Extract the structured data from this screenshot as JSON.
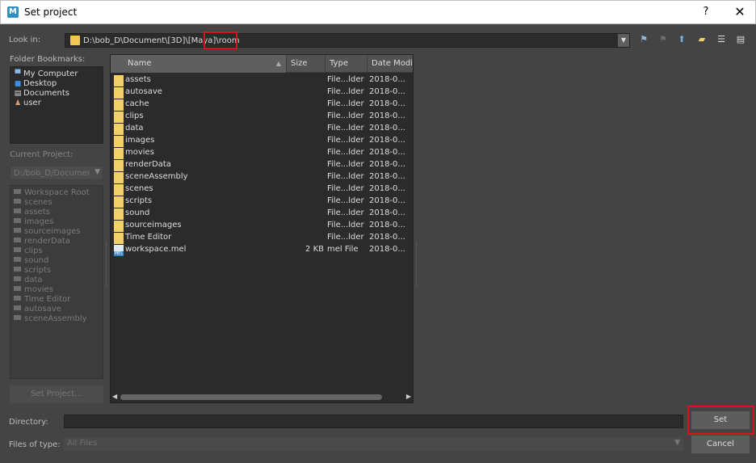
{
  "window": {
    "title": "Set project",
    "app_icon": "M",
    "help": "?",
    "close": "✕"
  },
  "lookin": {
    "label": "Look in:",
    "path": "D:\\bob_D\\Document\\[3D]\\[Maya]\\room"
  },
  "toolbar_icons": [
    "back-icon",
    "forward-icon",
    "parent-folder-icon",
    "new-folder-icon",
    "list-view-icon",
    "detail-view-icon"
  ],
  "bookmarks": {
    "label": "Folder Bookmarks:",
    "items": [
      {
        "label": "My Computer",
        "icon": "computer-icon"
      },
      {
        "label": "Desktop",
        "icon": "desktop-icon"
      },
      {
        "label": "Documents",
        "icon": "documents-icon"
      },
      {
        "label": "user",
        "icon": "user-icon"
      }
    ]
  },
  "current_project": {
    "label": "Current Project:",
    "value": "D:/bob_D/Documen"
  },
  "workspace": {
    "items": [
      "Workspace Root",
      "scenes",
      "assets",
      "images",
      "sourceimages",
      "renderData",
      "clips",
      "sound",
      "scripts",
      "data",
      "movies",
      "Time Editor",
      "autosave",
      "sceneAssembly"
    ]
  },
  "set_project_button": "Set Project...",
  "filelist": {
    "columns": [
      "Name",
      "Size",
      "Type",
      "Date Modi"
    ],
    "rows": [
      {
        "name": "assets",
        "size": "",
        "type": "File...lder",
        "date": "2018-0...",
        "kind": "folder"
      },
      {
        "name": "autosave",
        "size": "",
        "type": "File...lder",
        "date": "2018-0...",
        "kind": "folder"
      },
      {
        "name": "cache",
        "size": "",
        "type": "File...lder",
        "date": "2018-0...",
        "kind": "folder"
      },
      {
        "name": "clips",
        "size": "",
        "type": "File...lder",
        "date": "2018-0...",
        "kind": "folder"
      },
      {
        "name": "data",
        "size": "",
        "type": "File...lder",
        "date": "2018-0...",
        "kind": "folder"
      },
      {
        "name": "images",
        "size": "",
        "type": "File...lder",
        "date": "2018-0...",
        "kind": "folder"
      },
      {
        "name": "movies",
        "size": "",
        "type": "File...lder",
        "date": "2018-0...",
        "kind": "folder"
      },
      {
        "name": "renderData",
        "size": "",
        "type": "File...lder",
        "date": "2018-0...",
        "kind": "folder"
      },
      {
        "name": "sceneAssembly",
        "size": "",
        "type": "File...lder",
        "date": "2018-0...",
        "kind": "folder"
      },
      {
        "name": "scenes",
        "size": "",
        "type": "File...lder",
        "date": "2018-0...",
        "kind": "folder"
      },
      {
        "name": "scripts",
        "size": "",
        "type": "File...lder",
        "date": "2018-0...",
        "kind": "folder"
      },
      {
        "name": "sound",
        "size": "",
        "type": "File...lder",
        "date": "2018-0...",
        "kind": "folder"
      },
      {
        "name": "sourceimages",
        "size": "",
        "type": "File...lder",
        "date": "2018-0...",
        "kind": "folder"
      },
      {
        "name": "Time Editor",
        "size": "",
        "type": "File...lder",
        "date": "2018-0...",
        "kind": "folder"
      },
      {
        "name": "workspace.mel",
        "size": "2 KB",
        "type": "mel File",
        "date": "2018-0...",
        "kind": "mel"
      }
    ]
  },
  "directory": {
    "label": "Directory:",
    "value": ""
  },
  "files_of_type": {
    "label": "Files of type:",
    "value": "All Files"
  },
  "buttons": {
    "set": "Set",
    "cancel": "Cancel"
  }
}
